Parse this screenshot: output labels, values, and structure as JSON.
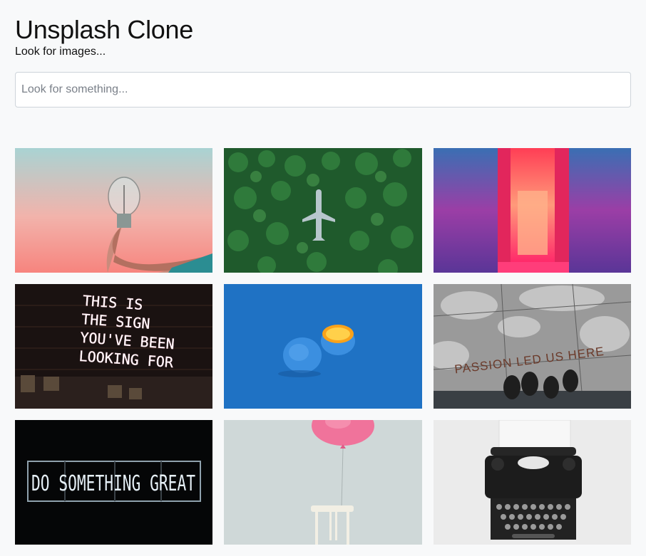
{
  "header": {
    "title": "Unsplash Clone",
    "subtitle": "Look for images..."
  },
  "search": {
    "placeholder": "Look for something...",
    "value": ""
  },
  "gallery": {
    "images": [
      {
        "subject": "hand holding light bulb",
        "icon": "lightbulb-photo"
      },
      {
        "subject": "airplane in forest",
        "icon": "plane-forest-photo"
      },
      {
        "subject": "neon corridor",
        "icon": "neon-corridor-photo"
      },
      {
        "subject": "neon sign",
        "text": [
          "THIS IS",
          "THE SIGN",
          "YOU'VE BEEN",
          "LOOKING FOR"
        ]
      },
      {
        "subject": "orange painted blue",
        "icon": "orange-photo"
      },
      {
        "subject": "pavement text",
        "text": "PASSION LED US HERE"
      },
      {
        "subject": "neon sign",
        "text": "DO SOMETHING GREAT"
      },
      {
        "subject": "pink balloon tied to chair",
        "icon": "balloon-chair-photo"
      },
      {
        "subject": "typewriter",
        "icon": "typewriter-photo"
      }
    ]
  }
}
